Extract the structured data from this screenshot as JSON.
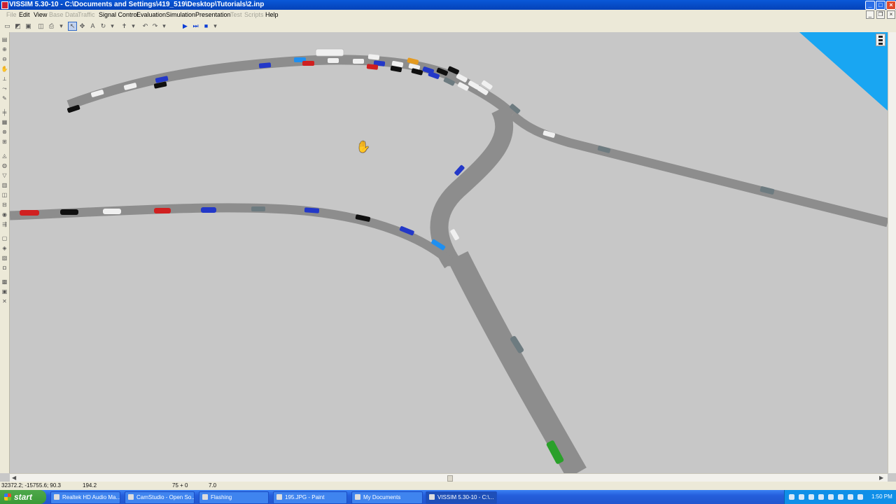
{
  "window": {
    "title": "VISSIM 5.30-10 - C:\\Documents and Settings\\419_519\\Desktop\\Tutorials\\2.inp",
    "controls": {
      "minimize": "_",
      "maximize": "□",
      "close": "×"
    }
  },
  "menu": {
    "items": [
      {
        "label": "File",
        "enabled": false
      },
      {
        "label": "Edit",
        "enabled": true
      },
      {
        "label": "View",
        "enabled": true
      },
      {
        "label": "Base Data",
        "enabled": false
      },
      {
        "label": "Traffic",
        "enabled": false
      },
      {
        "label": "Signal Control",
        "enabled": true
      },
      {
        "label": "Evaluation",
        "enabled": true
      },
      {
        "label": "Simulation",
        "enabled": true
      },
      {
        "label": "Presentation",
        "enabled": true
      },
      {
        "label": "Test",
        "enabled": false
      },
      {
        "label": "Scripts",
        "enabled": false
      },
      {
        "label": "Help",
        "enabled": true
      }
    ]
  },
  "toolbar": {
    "icons": [
      "new-icon",
      "open-icon",
      "save-icon",
      "print-preview-icon",
      "print-icon",
      "dropdown-icon",
      "select-icon",
      "zoom-icon",
      "text-icon",
      "rotate-icon",
      "dropdown-icon",
      "pedestrian-icon",
      "dropdown-icon",
      "undo-icon",
      "redo-icon",
      "dropdown-icon",
      "play-icon",
      "step-icon",
      "stop-icon",
      "dropdown-icon"
    ]
  },
  "network": {
    "road_color": "#8d8d8d",
    "background_color": "#c7c7c7",
    "water_color": "#19a6f2",
    "vehicle_colors": [
      "#d02020",
      "#101010",
      "#f0f0f0",
      "#2338c8",
      "#6d7b80",
      "#1f8ff0",
      "#e49a20",
      "#2aa02a"
    ]
  },
  "statusbar": {
    "coordinates": "32372.2; -15755.6; 90.3",
    "time": "194.2",
    "sim_step": "75 + 0",
    "speed": "7.0"
  },
  "taskbar": {
    "start_label": "start",
    "tasks": [
      {
        "label": "Realtek HD Audio Ma...",
        "active": false
      },
      {
        "label": "CamStudio - Open So...",
        "active": false
      },
      {
        "label": "Flashing",
        "active": false
      },
      {
        "label": "195.JPG - Paint",
        "active": false
      },
      {
        "label": "My Documents",
        "active": false
      },
      {
        "label": "VISSIM 5.30-10 - C:\\...",
        "active": true
      }
    ],
    "clock": "1:50 PM"
  }
}
